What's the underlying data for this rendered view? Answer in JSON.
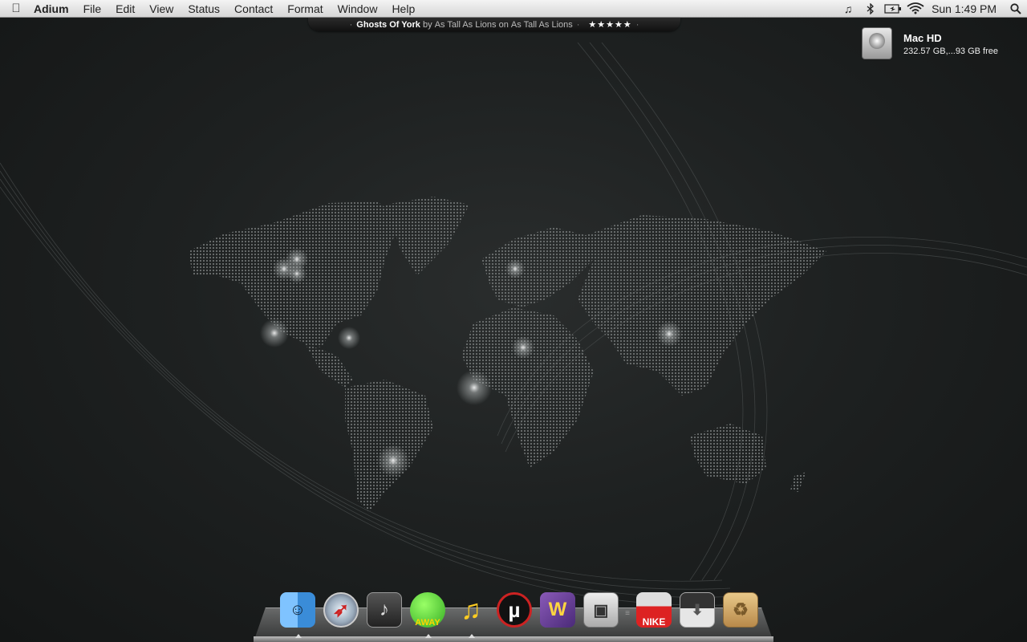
{
  "menubar": {
    "apple": "",
    "app_name": "Adium",
    "items": [
      "File",
      "Edit",
      "View",
      "Status",
      "Contact",
      "Format",
      "Window",
      "Help"
    ],
    "status_icons": [
      "music-note-icon",
      "bluetooth-icon",
      "battery-icon",
      "wifi-icon"
    ],
    "clock": "Sun 1:49 PM",
    "spotlight": "search-icon"
  },
  "now_playing": {
    "song": "Ghosts Of York",
    "by": "by",
    "artist": "As Tall As Lions",
    "on": "on",
    "album": "As Tall As Lions",
    "rating": "★★★★★"
  },
  "desktop": {
    "drive_name": "Mac HD",
    "drive_info": "232.57 GB,...93 GB free"
  },
  "dock": {
    "items": [
      {
        "name": "Finder",
        "icon": "finder-icon",
        "running": true
      },
      {
        "name": "Safari",
        "icon": "safari-icon",
        "running": false
      },
      {
        "name": "Audio App",
        "icon": "music-app-icon",
        "running": false
      },
      {
        "name": "Adium",
        "icon": "adium-duck-icon",
        "running": true
      },
      {
        "name": "iTunes",
        "icon": "itunes-icon",
        "running": true
      },
      {
        "name": "uTorrent",
        "icon": "utorrent-icon",
        "running": false
      },
      {
        "name": "Wunderkit",
        "icon": "w-app-icon",
        "running": false
      },
      {
        "name": "Preview",
        "icon": "preview-icon",
        "running": false
      },
      {
        "name": "Sneakers Folder",
        "icon": "sneaker-box-icon",
        "running": false
      },
      {
        "name": "Downloads",
        "icon": "downloads-stack-icon",
        "running": false
      },
      {
        "name": "Trash",
        "icon": "trash-box-icon",
        "running": false
      }
    ],
    "accent": "#3a8cd8"
  }
}
